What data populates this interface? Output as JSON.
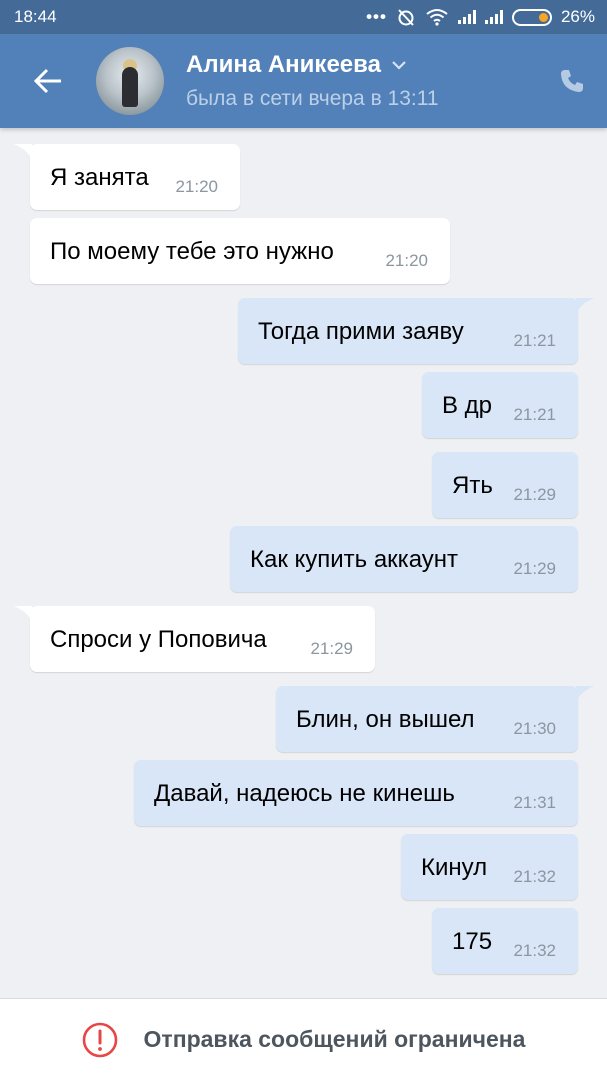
{
  "status_bar": {
    "time": "18:44",
    "battery": "26%",
    "battery_level": 0.26,
    "icons": [
      "more-dots-icon",
      "alarm-off-icon",
      "wifi-icon",
      "signal-icon",
      "signal-icon",
      "battery-icon"
    ]
  },
  "header": {
    "name": "Алина Аникеева",
    "last_seen": "была в сети вчера в 13:11"
  },
  "messages": [
    {
      "dir": "in",
      "text": "Я занята",
      "time": "21:20"
    },
    {
      "dir": "in",
      "text": "По моему тебе это нужно",
      "time": "21:20"
    },
    {
      "dir": "out",
      "text": "Тогда прими заяву",
      "time": "21:21"
    },
    {
      "dir": "out",
      "text": "В др",
      "time": "21:21"
    },
    {
      "dir": "out",
      "text": "Ять",
      "time": "21:29"
    },
    {
      "dir": "out",
      "text": "Как купить аккаунт",
      "time": "21:29"
    },
    {
      "dir": "in",
      "text": "Спроси у Поповича",
      "time": "21:29"
    },
    {
      "dir": "out",
      "text": "Блин, он вышел",
      "time": "21:30"
    },
    {
      "dir": "out",
      "text": "Давай, надеюсь не кинешь",
      "time": "21:31"
    },
    {
      "dir": "out",
      "text": "Кинул",
      "time": "21:32"
    },
    {
      "dir": "out",
      "text": "175",
      "time": "21:32"
    }
  ],
  "footer": {
    "restricted": "Отправка сообщений ограничена"
  },
  "colors": {
    "header": "#5181b8",
    "statusbar": "#446b98",
    "outgoing": "#d9e6f7",
    "incoming": "#ffffff",
    "background": "#eef0f3",
    "warning": "#e64646"
  }
}
